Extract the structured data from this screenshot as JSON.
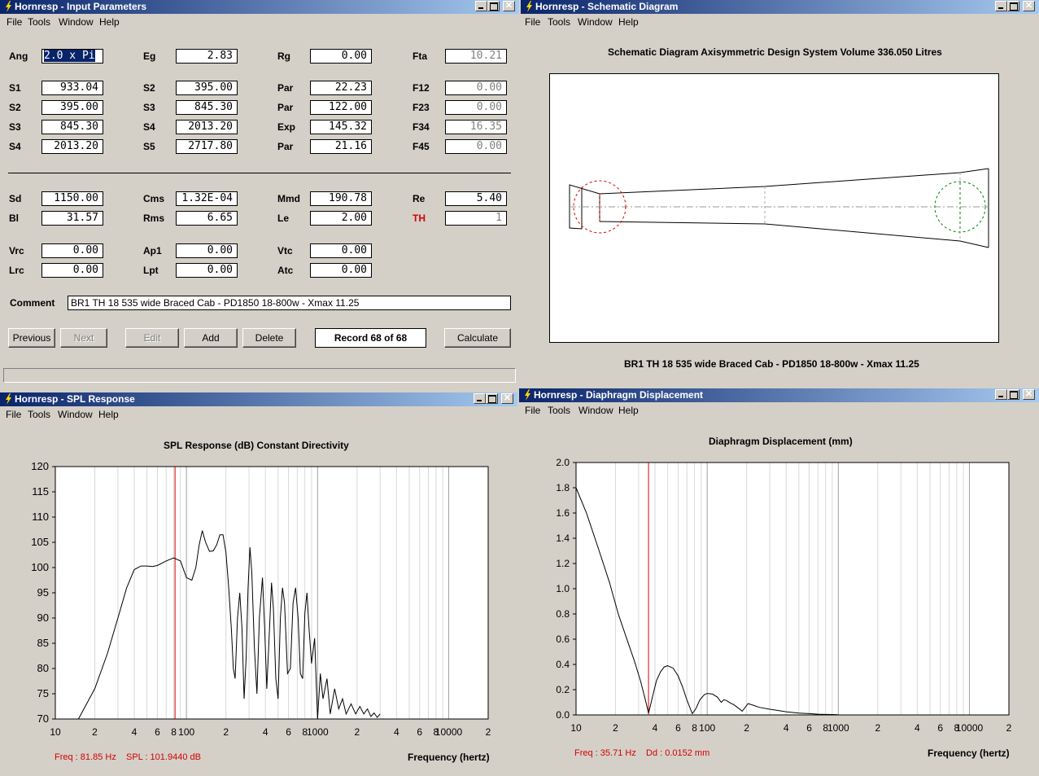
{
  "menu": [
    "File",
    "Tools",
    "Window",
    "Help"
  ],
  "input_params": {
    "title": "Hornresp - Input Parameters",
    "rows": [
      [
        {
          "l": "Ang",
          "v": "2.0 x Pi",
          "sel": true
        },
        {
          "l": "Eg",
          "v": "2.83"
        },
        {
          "l": "Rg",
          "v": "0.00"
        },
        {
          "l": "Fta",
          "v": "10.21",
          "dis": true
        }
      ],
      [
        {
          "l": "S1",
          "v": "933.04"
        },
        {
          "l": "S2",
          "v": "395.00"
        },
        {
          "l": "Par",
          "v": "22.23"
        },
        {
          "l": "F12",
          "v": "0.00",
          "dis": true
        }
      ],
      [
        {
          "l": "S2",
          "v": "395.00"
        },
        {
          "l": "S3",
          "v": "845.30"
        },
        {
          "l": "Par",
          "v": "122.00"
        },
        {
          "l": "F23",
          "v": "0.00",
          "dis": true
        }
      ],
      [
        {
          "l": "S3",
          "v": "845.30"
        },
        {
          "l": "S4",
          "v": "2013.20"
        },
        {
          "l": "Exp",
          "v": "145.32"
        },
        {
          "l": "F34",
          "v": "16.35",
          "dis": true
        }
      ],
      [
        {
          "l": "S4",
          "v": "2013.20"
        },
        {
          "l": "S5",
          "v": "2717.80"
        },
        {
          "l": "Par",
          "v": "21.16"
        },
        {
          "l": "F45",
          "v": "0.00",
          "dis": true
        }
      ],
      [
        {
          "l": "Sd",
          "v": "1150.00"
        },
        {
          "l": "Cms",
          "v": "1.32E-04"
        },
        {
          "l": "Mmd",
          "v": "190.78"
        },
        {
          "l": "Re",
          "v": "5.40"
        }
      ],
      [
        {
          "l": "Bl",
          "v": "31.57"
        },
        {
          "l": "Rms",
          "v": "6.65"
        },
        {
          "l": "Le",
          "v": "2.00"
        },
        {
          "l": "TH",
          "v": "1",
          "dis": true,
          "red": true
        }
      ],
      [
        {
          "l": "Vrc",
          "v": "0.00"
        },
        {
          "l": "Ap1",
          "v": "0.00"
        },
        {
          "l": "Vtc",
          "v": "0.00"
        }
      ],
      [
        {
          "l": "Lrc",
          "v": "0.00"
        },
        {
          "l": "Lpt",
          "v": "0.00"
        },
        {
          "l": "Atc",
          "v": "0.00"
        }
      ]
    ],
    "comment_label": "Comment",
    "comment": "BR1 TH 18  535 wide Braced Cab - PD1850 18-800w - Xmax 11.25",
    "buttons": {
      "previous": "Previous",
      "next": "Next",
      "edit": "Edit",
      "add": "Add",
      "delete": "Delete",
      "calculate": "Calculate"
    },
    "record": "Record 68 of 68"
  },
  "schematic": {
    "title": "Hornresp - Schematic Diagram",
    "header": "Schematic Diagram   Axisymmetric Design   System Volume 336.050 Litres",
    "caption": "BR1 TH 18  535 wide Braced Cab - PD1850 18-800w - Xmax 11.25"
  },
  "spl": {
    "title": "Hornresp - SPL Response",
    "chart_title": "SPL Response (dB)   Constant Directivity",
    "xlabel": "Frequency (hertz)",
    "status_freq": "Freq : 81.85 Hz",
    "status_val": "SPL : 101.9440 dB"
  },
  "disp": {
    "title": "Hornresp - Diaphragm Displacement",
    "chart_title": "Diaphragm Displacement (mm)",
    "xlabel": "Frequency (hertz)",
    "status_freq": "Freq : 35.71 Hz",
    "status_val": "Dd : 0.0152 mm"
  },
  "colors": {
    "cursor": "#d40000",
    "circle_left": "#d40000",
    "circle_right": "#008000"
  },
  "chart_data": [
    {
      "type": "line",
      "title": "SPL Response (dB)   Constant Directivity",
      "xlabel": "Frequency (hertz)",
      "x_scale": "log",
      "xlim": [
        10,
        20000
      ],
      "ylim": [
        70,
        120
      ],
      "yticks": [
        "120",
        "115",
        "110",
        "105",
        "100",
        "95",
        "90",
        "85",
        "80",
        "75",
        "70"
      ],
      "xticks": [
        "10",
        "2",
        "4",
        "6",
        "8",
        "100",
        "2",
        "4",
        "6",
        "8",
        "1000",
        "2",
        "4",
        "6",
        "8",
        "10000",
        "2"
      ],
      "cursor_x": 81.85,
      "series": [
        {
          "points": [
            [
              15,
              70
            ],
            [
              20,
              76
            ],
            [
              25,
              83
            ],
            [
              30,
              90
            ],
            [
              35,
              96
            ],
            [
              40,
              99.6
            ],
            [
              45,
              100.3
            ],
            [
              50,
              100.3
            ],
            [
              55,
              100.2
            ],
            [
              60,
              100.4
            ],
            [
              70,
              101.3
            ],
            [
              80,
              101.9
            ],
            [
              90,
              101.3
            ],
            [
              100,
              98
            ],
            [
              110,
              97.5
            ],
            [
              118,
              100
            ],
            [
              125,
              104.5
            ],
            [
              132,
              107.3
            ],
            [
              140,
              105
            ],
            [
              150,
              103.2
            ],
            [
              160,
              103.3
            ],
            [
              170,
              104.5
            ],
            [
              180,
              106.5
            ],
            [
              190,
              106.5
            ],
            [
              200,
              103
            ],
            [
              210,
              96
            ],
            [
              220,
              88
            ],
            [
              228,
              80
            ],
            [
              235,
              78
            ],
            [
              245,
              90
            ],
            [
              255,
              95
            ],
            [
              265,
              88
            ],
            [
              275,
              74
            ],
            [
              285,
              82
            ],
            [
              295,
              96
            ],
            [
              305,
              104
            ],
            [
              315,
              99
            ],
            [
              330,
              84
            ],
            [
              345,
              75
            ],
            [
              360,
              90
            ],
            [
              380,
              98
            ],
            [
              395,
              88
            ],
            [
              410,
              76
            ],
            [
              430,
              88
            ],
            [
              445,
              97
            ],
            [
              460,
              92
            ],
            [
              480,
              78
            ],
            [
              500,
              74
            ],
            [
              520,
              90
            ],
            [
              540,
              96
            ],
            [
              560,
              93
            ],
            [
              590,
              79
            ],
            [
              620,
              80
            ],
            [
              650,
              93
            ],
            [
              680,
              96
            ],
            [
              710,
              90
            ],
            [
              740,
              79
            ],
            [
              770,
              78
            ],
            [
              800,
              91
            ],
            [
              830,
              95
            ],
            [
              860,
              88
            ],
            [
              900,
              81
            ],
            [
              950,
              86
            ],
            [
              1000,
              70
            ],
            [
              1050,
              79
            ],
            [
              1100,
              74
            ],
            [
              1180,
              78
            ],
            [
              1250,
              71
            ],
            [
              1350,
              76
            ],
            [
              1450,
              72
            ],
            [
              1550,
              74
            ],
            [
              1650,
              71
            ],
            [
              1800,
              73
            ],
            [
              1950,
              71
            ],
            [
              2100,
              72.5
            ],
            [
              2250,
              71
            ],
            [
              2400,
              72
            ],
            [
              2550,
              70.5
            ],
            [
              2700,
              71.2
            ],
            [
              2850,
              70.3
            ],
            [
              3000,
              71
            ]
          ]
        }
      ]
    },
    {
      "type": "line",
      "title": "Diaphragm Displacement (mm)",
      "xlabel": "Frequency (hertz)",
      "x_scale": "log",
      "xlim": [
        10,
        20000
      ],
      "ylim": [
        0,
        2.0
      ],
      "yticks": [
        "2.0",
        "1.8",
        "1.6",
        "1.4",
        "1.2",
        "1.0",
        "0.8",
        "0.6",
        "0.4",
        "0.2",
        "0.0"
      ],
      "xticks": [
        "10",
        "2",
        "4",
        "6",
        "8",
        "100",
        "2",
        "4",
        "6",
        "8",
        "1000",
        "2",
        "4",
        "6",
        "8",
        "10000",
        "2"
      ],
      "cursor_x": 35.71,
      "series": [
        {
          "points": [
            [
              10,
              1.8
            ],
            [
              12,
              1.6
            ],
            [
              15,
              1.3
            ],
            [
              18,
              1.05
            ],
            [
              21,
              0.8
            ],
            [
              25,
              0.57
            ],
            [
              28,
              0.42
            ],
            [
              31,
              0.27
            ],
            [
              33,
              0.16
            ],
            [
              34.5,
              0.08
            ],
            [
              35.7,
              0.015
            ],
            [
              37,
              0.08
            ],
            [
              39,
              0.18
            ],
            [
              41,
              0.27
            ],
            [
              44,
              0.34
            ],
            [
              47,
              0.38
            ],
            [
              50,
              0.39
            ],
            [
              55,
              0.37
            ],
            [
              60,
              0.31
            ],
            [
              65,
              0.22
            ],
            [
              70,
              0.12
            ],
            [
              75,
              0.04
            ],
            [
              77,
              0.01
            ],
            [
              82,
              0.05
            ],
            [
              88,
              0.12
            ],
            [
              95,
              0.16
            ],
            [
              100,
              0.17
            ],
            [
              110,
              0.165
            ],
            [
              120,
              0.14
            ],
            [
              128,
              0.1
            ],
            [
              134,
              0.12
            ],
            [
              140,
              0.115
            ],
            [
              150,
              0.095
            ],
            [
              160,
              0.08
            ],
            [
              170,
              0.06
            ],
            [
              185,
              0.03
            ],
            [
              195,
              0.06
            ],
            [
              205,
              0.09
            ],
            [
              220,
              0.08
            ],
            [
              250,
              0.06
            ],
            [
              300,
              0.045
            ],
            [
              350,
              0.035
            ],
            [
              400,
              0.025
            ],
            [
              500,
              0.015
            ],
            [
              600,
              0.01
            ],
            [
              700,
              0.006
            ],
            [
              800,
              0.004
            ],
            [
              900,
              0.003
            ],
            [
              1000,
              0.002
            ]
          ]
        }
      ]
    }
  ]
}
